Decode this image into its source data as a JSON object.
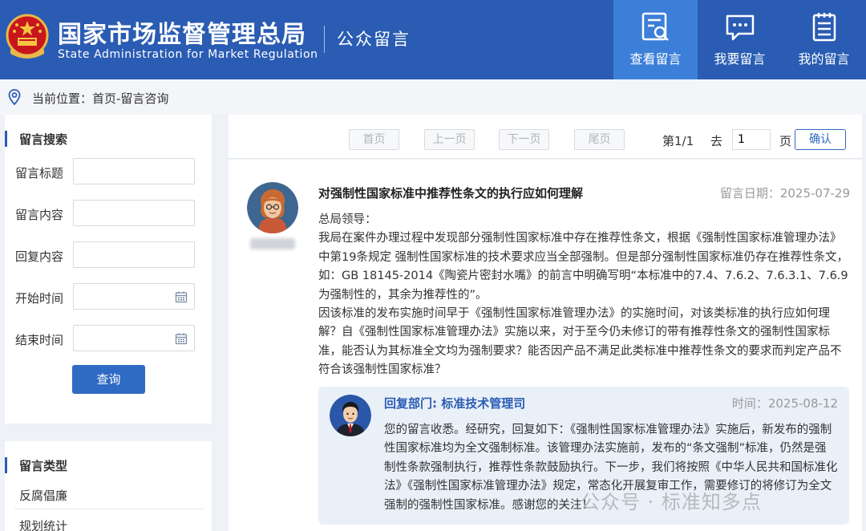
{
  "header": {
    "title_zh": "国家市场监督管理总局",
    "title_en": "State Administration for Market Regulation",
    "section": "公众留言",
    "nav": [
      {
        "label": "查看留言",
        "icon": "search-message-icon",
        "active": true
      },
      {
        "label": "我要留言",
        "icon": "chat-bubble-icon",
        "active": false
      },
      {
        "label": "我的留言",
        "icon": "notepad-icon",
        "active": false
      }
    ]
  },
  "breadcrumb": {
    "text": "当前位置：首页-留言咨询"
  },
  "search": {
    "title": "留言搜索",
    "fields": [
      {
        "label": "留言标题",
        "value": ""
      },
      {
        "label": "留言内容",
        "value": ""
      },
      {
        "label": "回复内容",
        "value": ""
      },
      {
        "label": "开始时间",
        "value": ""
      },
      {
        "label": "结束时间",
        "value": ""
      }
    ],
    "submit": "查询"
  },
  "types": {
    "title": "留言类型",
    "items": [
      "反腐倡廉",
      "规划统计"
    ]
  },
  "pager": {
    "first": "首页",
    "prev": "上一页",
    "next": "下一页",
    "last": "尾页",
    "page_info": "第1/1",
    "go_label": "去",
    "page_value": "1",
    "page_unit": "页",
    "confirm": "确认"
  },
  "message": {
    "title": "对强制性国家标准中推荐性条文的执行应如何理解",
    "date": "留言日期：2025-07-29",
    "greeting": "总局领导：",
    "paragraph1": "我局在案件办理过程中发现部分强制性国家标准中存在推荐性条文，根据《强制性国家标准管理办法》中第19条规定 强制性国家标准的技术要求应当全部强制。但是部分强制性国家标准仍存在推荐性条文，如：GB 18145-2014《陶瓷片密封水嘴》的前言中明确写明“本标准中的7.4、7.6.2、7.6.3.1、7.6.9为强制性的，其余为推荐性的”。",
    "paragraph2": "因该标准的发布实施时间早于《强制性国家标准管理办法》的实施时间，对该类标准的执行应如何理解？自《强制性国家标准管理办法》实施以来，对于至今仍未修订的带有推荐性条文的强制性国家标准，能否认为其标准全文均为强制要求？能否因产品不满足此类标准中推荐性条文的要求而判定产品不符合该强制性国家标准？"
  },
  "reply": {
    "department": "回复部门: 标准技术管理司",
    "time": "时间：2025-08-12",
    "body": "您的留言收悉。经研究，回复如下：《强制性国家标准管理办法》实施后，新发布的强制性国家标准均为全文强制标准。该管理办法实施前，发布的“条文强制”标准，仍然是强制性条款强制执行，推荐性条款鼓励执行。下一步，我们将按照《中华人民共和国标准化法》《强制性国家标准管理办法》规定，常态化开展复审工作，需要修订的将修订为全文强制的强制性国家标准。感谢您的关注！"
  },
  "watermark": "公众号 · 标准知多点",
  "colors": {
    "header_bg": "#2a5cb3",
    "nav_active": "#3c7fd8",
    "button_blue": "#2f6ac4",
    "reply_bg": "#eaf0f8"
  }
}
